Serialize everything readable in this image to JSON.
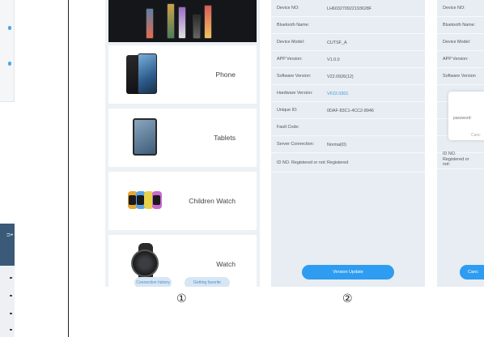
{
  "panel1": {
    "categories": [
      {
        "label": "Phone"
      },
      {
        "label": "Tablets"
      },
      {
        "label": "Children Watch"
      },
      {
        "label": "Watch"
      }
    ],
    "bottom_buttons": [
      "Connection history",
      "Getting favorite"
    ]
  },
  "panel2": {
    "rows": [
      {
        "key": "Device NO:",
        "value": "LH603270922193628F"
      },
      {
        "key": "Bluetooth Name:",
        "value": ""
      },
      {
        "key": "Device Model:",
        "value": "CUTSF_A"
      },
      {
        "key": "APP Version:",
        "value": "V1.0.0"
      },
      {
        "key": "Software Version:",
        "value": "V22.0926(12)"
      },
      {
        "key": "Hardware Version:",
        "value": "VF22.0301"
      },
      {
        "key": "Unique ID:",
        "value": "0DAF-83C1-4CC2-8946"
      },
      {
        "key": "Fault Code:",
        "value": ""
      },
      {
        "key": "Server Connection:",
        "value": "Normal(0)"
      },
      {
        "key": "ID NO. Registered or not:",
        "value": "Registered"
      }
    ],
    "update_button": "Version Update"
  },
  "panel3": {
    "rows": [
      "Device NO:",
      "Bluetooth Name:",
      "Device Model:",
      "APP Version:",
      "Software Version"
    ],
    "bottom_row": "ID NO. Registered or not:",
    "dialog": {
      "label": "password:",
      "cancel": "Canc"
    },
    "update_button": "Canc"
  },
  "markers": [
    "①",
    "②"
  ],
  "colors": {
    "accent": "#2e9cf0",
    "link": "#3a9ae0",
    "panel_bg": "#e7edf2"
  }
}
